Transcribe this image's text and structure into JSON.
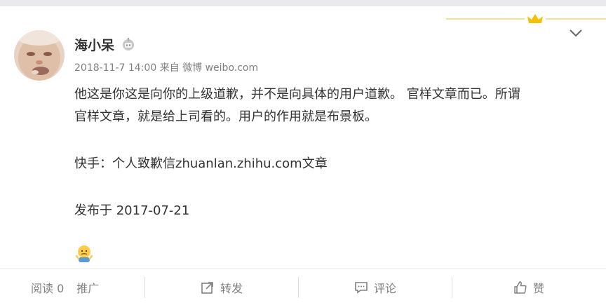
{
  "post": {
    "username": "海小呆",
    "meta_time": "2018-11-7 14:00",
    "meta_from": "来自",
    "meta_source": "微博 weibo.com",
    "content": {
      "line1": "他这是你这是向你的上级道歉，并不是向具体的用户道歉。 官样文章而已。所谓",
      "line2": "官样文章，就是给上司看的。用户的作用就是布景板。",
      "line3": "快手：个人致歉信zhuanlan.zhihu.com文章",
      "line4": "发布于 2017-07-21"
    }
  },
  "actions": {
    "read_label": "阅读 0",
    "promote_label": "推广",
    "repost_label": "转发",
    "comment_label": "评论",
    "like_label": "赞"
  },
  "icons": {
    "badge": "robot-badge-icon",
    "menu": "chevron-down-icon",
    "repost": "share-icon",
    "comment": "comment-icon",
    "like": "thumbs-up-icon",
    "emoji": "shrug-emoji-icon"
  },
  "colors": {
    "accent_gold": "#f5c000",
    "text_main": "#333333",
    "text_muted": "#808080"
  }
}
